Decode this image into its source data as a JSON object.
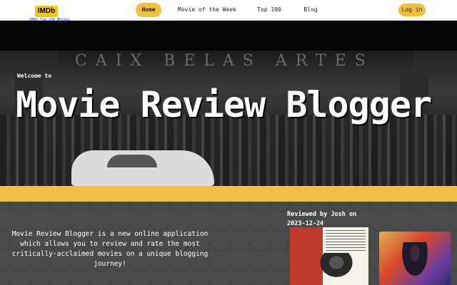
{
  "navbar": {
    "logo_text": "IMDb",
    "logo_link": "IMDb Top 250 Movies",
    "items": [
      {
        "label": "Home",
        "active": true
      },
      {
        "label": "Movie of the Week",
        "active": false
      },
      {
        "label": "Top 100",
        "active": false
      },
      {
        "label": "Blog",
        "active": false
      }
    ],
    "login_label": "Log in"
  },
  "hero": {
    "welcome": "Welcome to",
    "title": "Movie Review Blogger",
    "sign_text": "CAIX  BELAS ARTES"
  },
  "content": {
    "intro": "Movie Review Blogger is a new online application which allows you to review and rate the most critically-acclaimed movies on a unique blogging journey!",
    "review_caption": "Reviewed by Josh on 2023-12-24"
  },
  "colors": {
    "accent": "#f0c040",
    "logo_bg": "#f5c518",
    "content_bg": "#4a4a4a"
  }
}
